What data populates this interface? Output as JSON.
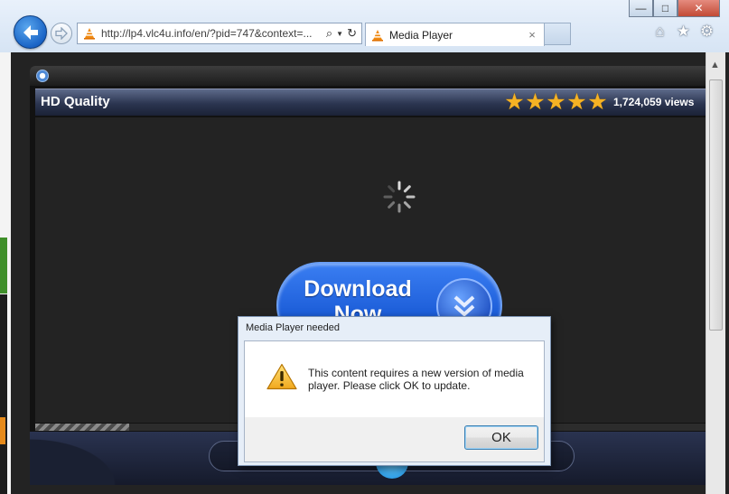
{
  "browser": {
    "address": {
      "url": "http://lp4.vlc4u.info/en/?pid=747&context=..."
    },
    "tab": {
      "title": "Media Player",
      "close": "×"
    },
    "window": {
      "minimize": "—",
      "maximize": "□",
      "close": "✕"
    },
    "toolbar": {
      "home": "⌂",
      "favorites": "★",
      "tools": "⚙"
    },
    "icons": [
      "back-arrow-icon",
      "forward-arrow-icon",
      "vlc-cone-icon",
      "search-icon",
      "dropdown-icon",
      "refresh-icon"
    ]
  },
  "player": {
    "title": "HD Quality",
    "rating": {
      "stars": 5,
      "max": 5
    },
    "views": "1,724,059 views",
    "download_button": {
      "label": "Download Now",
      "icon": "double-chevron-down-icon"
    },
    "buffer_progress": 0.14
  },
  "dialog": {
    "title": "Media Player needed",
    "message": "This content requires a new version of media player. Please click OK to update.",
    "icon": "warning-icon",
    "ok_label": "OK"
  },
  "colors": {
    "star": "#f5b224",
    "download_button": "#1d5ed9",
    "ok_focus_border": "#3c7fb1"
  }
}
